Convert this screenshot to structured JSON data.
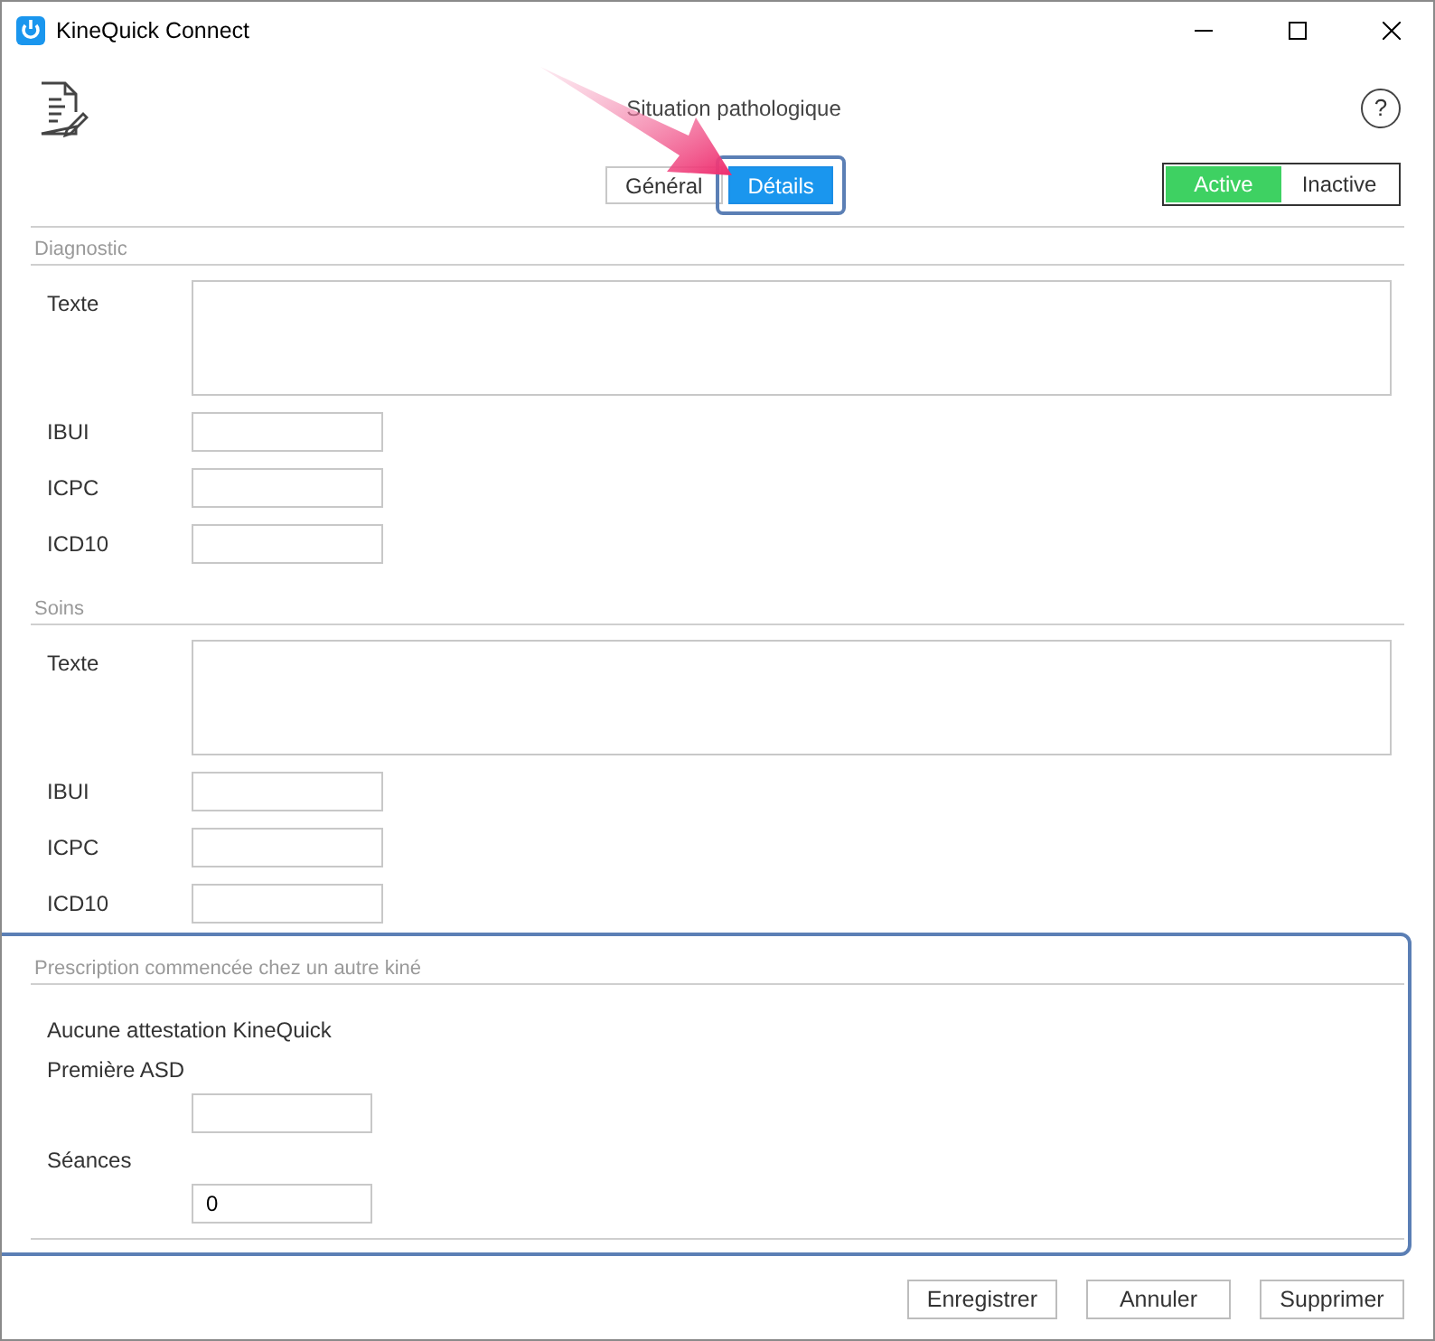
{
  "window": {
    "title": "KineQuick Connect"
  },
  "header": {
    "title": "Situation pathologique",
    "help": "?"
  },
  "tabs": [
    {
      "label": "Général",
      "selected": false,
      "highlighted": false
    },
    {
      "label": "Détails",
      "selected": true,
      "highlighted": true
    }
  ],
  "status_toggle": [
    {
      "label": "Active",
      "selected": true
    },
    {
      "label": "Inactive",
      "selected": false
    }
  ],
  "sections": [
    {
      "title": "Diagnostic",
      "highlighted": false,
      "items": [
        {
          "kind": "textarea",
          "label": "Texte"
        },
        {
          "kind": "input",
          "label": "IBUI"
        },
        {
          "kind": "input",
          "label": "ICPC"
        },
        {
          "kind": "input",
          "label": "ICD10"
        }
      ]
    },
    {
      "title": "Soins",
      "highlighted": false,
      "items": [
        {
          "kind": "textarea",
          "label": "Texte"
        },
        {
          "kind": "input",
          "label": "IBUI"
        },
        {
          "kind": "input",
          "label": "ICPC"
        },
        {
          "kind": "input",
          "label": "ICD10"
        }
      ]
    },
    {
      "title": "Prescription commencée chez un autre kiné",
      "highlighted": true,
      "items": [
        {
          "kind": "note",
          "label": "Aucune attestation KineQuick"
        },
        {
          "kind": "stacked",
          "label": "Première ASD"
        },
        {
          "kind": "stacked",
          "label": "Séances",
          "value": "0"
        }
      ]
    }
  ],
  "buttons": [
    "Enregistrer",
    "Annuler",
    "Supprimer"
  ]
}
